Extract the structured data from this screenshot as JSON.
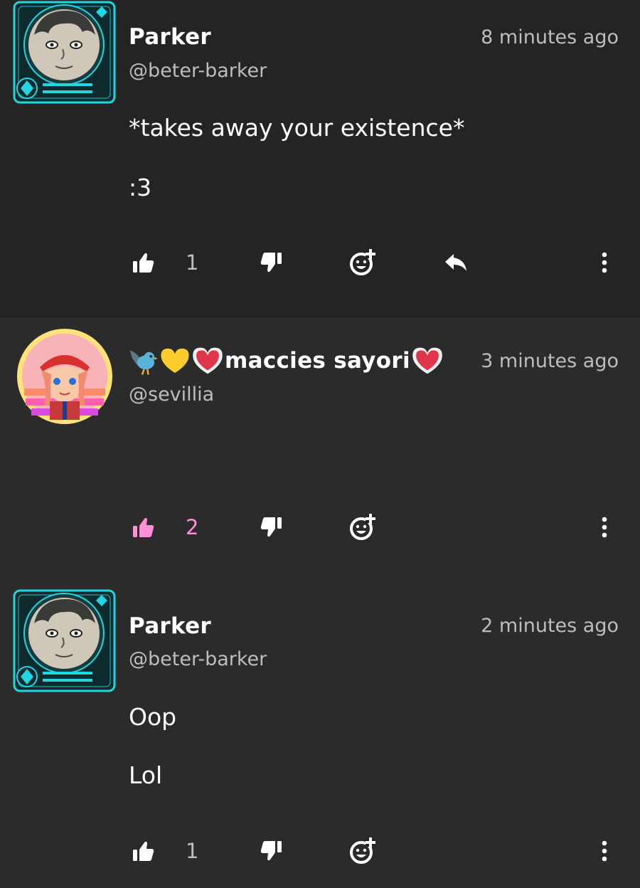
{
  "colors": {
    "background": "#2b2b2b",
    "highlighted_background": "#242424",
    "text_primary": "#ffffff",
    "text_secondary": "#bdbdbd",
    "liked_accent": "#ff8fd7",
    "avatar_frame_cyan": "#21d6e0"
  },
  "comments": [
    {
      "author": "Parker",
      "handle": "@beter-barker",
      "time": "8 minutes ago",
      "lines": [
        "*takes away your existence*",
        ":3"
      ],
      "likes": "1",
      "liked": false,
      "has_reply": true
    },
    {
      "author_prefix_emojis": [
        "bird-emoji",
        "yellow-heart-emoji",
        "heart-emoji"
      ],
      "author": "maccies sayori",
      "author_suffix_emojis": [
        "heart-emoji"
      ],
      "handle": "@sevillia",
      "time": "3 minutes ago",
      "lines": [],
      "likes": "2",
      "liked": true,
      "has_reply": false
    },
    {
      "author": "Parker",
      "handle": "@beter-barker",
      "time": "2 minutes ago",
      "lines": [
        "Oop",
        "Lol"
      ],
      "likes": "1",
      "liked": false,
      "has_reply": false
    }
  ],
  "icons": {
    "like": "thumbs-up-icon",
    "dislike": "thumbs-down-icon",
    "react": "add-reaction-icon",
    "reply": "reply-icon",
    "more": "more-vertical-icon"
  }
}
